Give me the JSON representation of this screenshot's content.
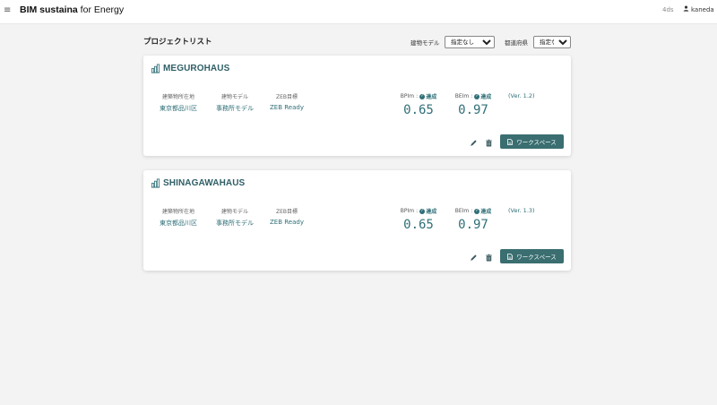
{
  "header": {
    "menu_icon": "hamburger-menu-icon",
    "brand_bold": "BIM sustaina",
    "brand_rest": " for Energy",
    "env": "4ds",
    "user": "kaneda"
  },
  "page": {
    "title": "プロジェクトリスト",
    "filters": {
      "building_model_label": "建物モデル",
      "building_model_value": "指定なし",
      "prefecture_label": "都道府県",
      "prefecture_value": "指定なし"
    }
  },
  "colors": {
    "accent": "#2f6f77",
    "button": "#3a6e70"
  },
  "projects": [
    {
      "name": "MEGUROHAUS",
      "location_label": "建築物所在地",
      "location": "東京都品川区",
      "model_label": "建物モデル",
      "model": "事務所モデル",
      "zeb_label": "ZEB目標",
      "zeb": "ZEB Ready",
      "bpi_label": "BPIm",
      "bpi_status": "達成",
      "bpi": "0.65",
      "bei_label": "BEIm",
      "bei_status": "達成",
      "bei": "0.97",
      "version": "(Ver. 1.2)",
      "workspace_label": "ワークスペース"
    },
    {
      "name": "SHINAGAWAHAUS",
      "location_label": "建築物所在地",
      "location": "東京都品川区",
      "model_label": "建物モデル",
      "model": "事務所モデル",
      "zeb_label": "ZEB目標",
      "zeb": "ZEB Ready",
      "bpi_label": "BPIm",
      "bpi_status": "達成",
      "bpi": "0.65",
      "bei_label": "BEIm",
      "bei_status": "達成",
      "bei": "0.97",
      "version": "(Ver. 1.3)",
      "workspace_label": "ワークスペース"
    }
  ]
}
